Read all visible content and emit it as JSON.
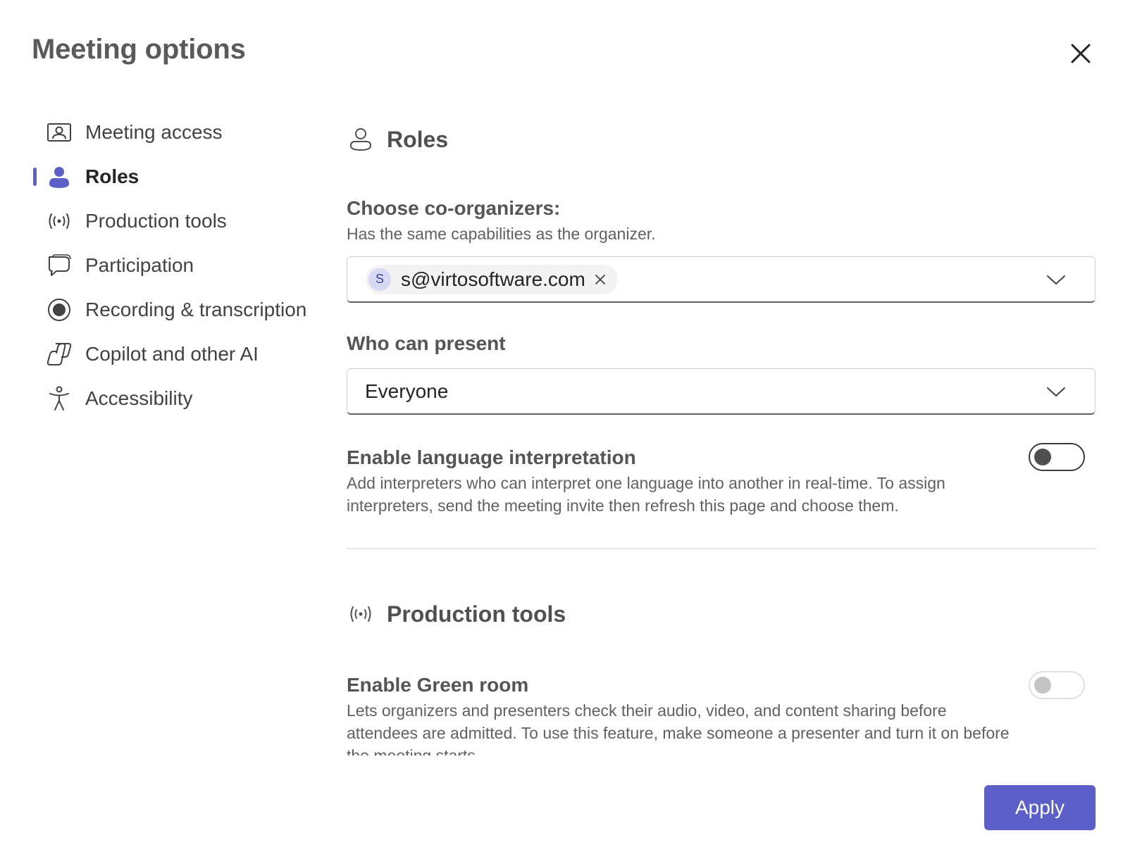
{
  "dialog": {
    "title": "Meeting options",
    "close_icon": "close-icon"
  },
  "sidebar": {
    "items": [
      {
        "label": "Meeting access",
        "icon": "meeting-access-icon",
        "active": false
      },
      {
        "label": "Roles",
        "icon": "person-icon",
        "active": true
      },
      {
        "label": "Production tools",
        "icon": "broadcast-icon",
        "active": false
      },
      {
        "label": "Participation",
        "icon": "chat-bubble-icon",
        "active": false
      },
      {
        "label": "Recording & transcription",
        "icon": "record-icon",
        "active": false
      },
      {
        "label": "Copilot and other AI",
        "icon": "copilot-icon",
        "active": false
      },
      {
        "label": "Accessibility",
        "icon": "accessibility-icon",
        "active": false
      }
    ]
  },
  "roles": {
    "title": "Roles",
    "co_organizers": {
      "label": "Choose co-organizers:",
      "help": "Has the same capabilities as the organizer.",
      "chip_initial": "S",
      "chip_email": "s@virtosoftware.com"
    },
    "who_can_present": {
      "label": "Who can present",
      "value": "Everyone"
    },
    "language_interpretation": {
      "label": "Enable language interpretation",
      "help": "Add interpreters who can interpret one language into another in real-time. To assign interpreters, send the meeting invite then refresh this page and choose them.",
      "enabled": false
    }
  },
  "production_tools": {
    "title": "Production tools",
    "green_room": {
      "label": "Enable Green room",
      "help": "Lets organizers and presenters check their audio, video, and content sharing before attendees are admitted. To use this feature, make someone a presenter and turn it on before the meeting starts.",
      "enabled": false,
      "disabled": true
    }
  },
  "footer": {
    "apply_label": "Apply"
  },
  "colors": {
    "accent": "#5b5fc7",
    "chip_avatar_bg": "#d8d9f5"
  }
}
